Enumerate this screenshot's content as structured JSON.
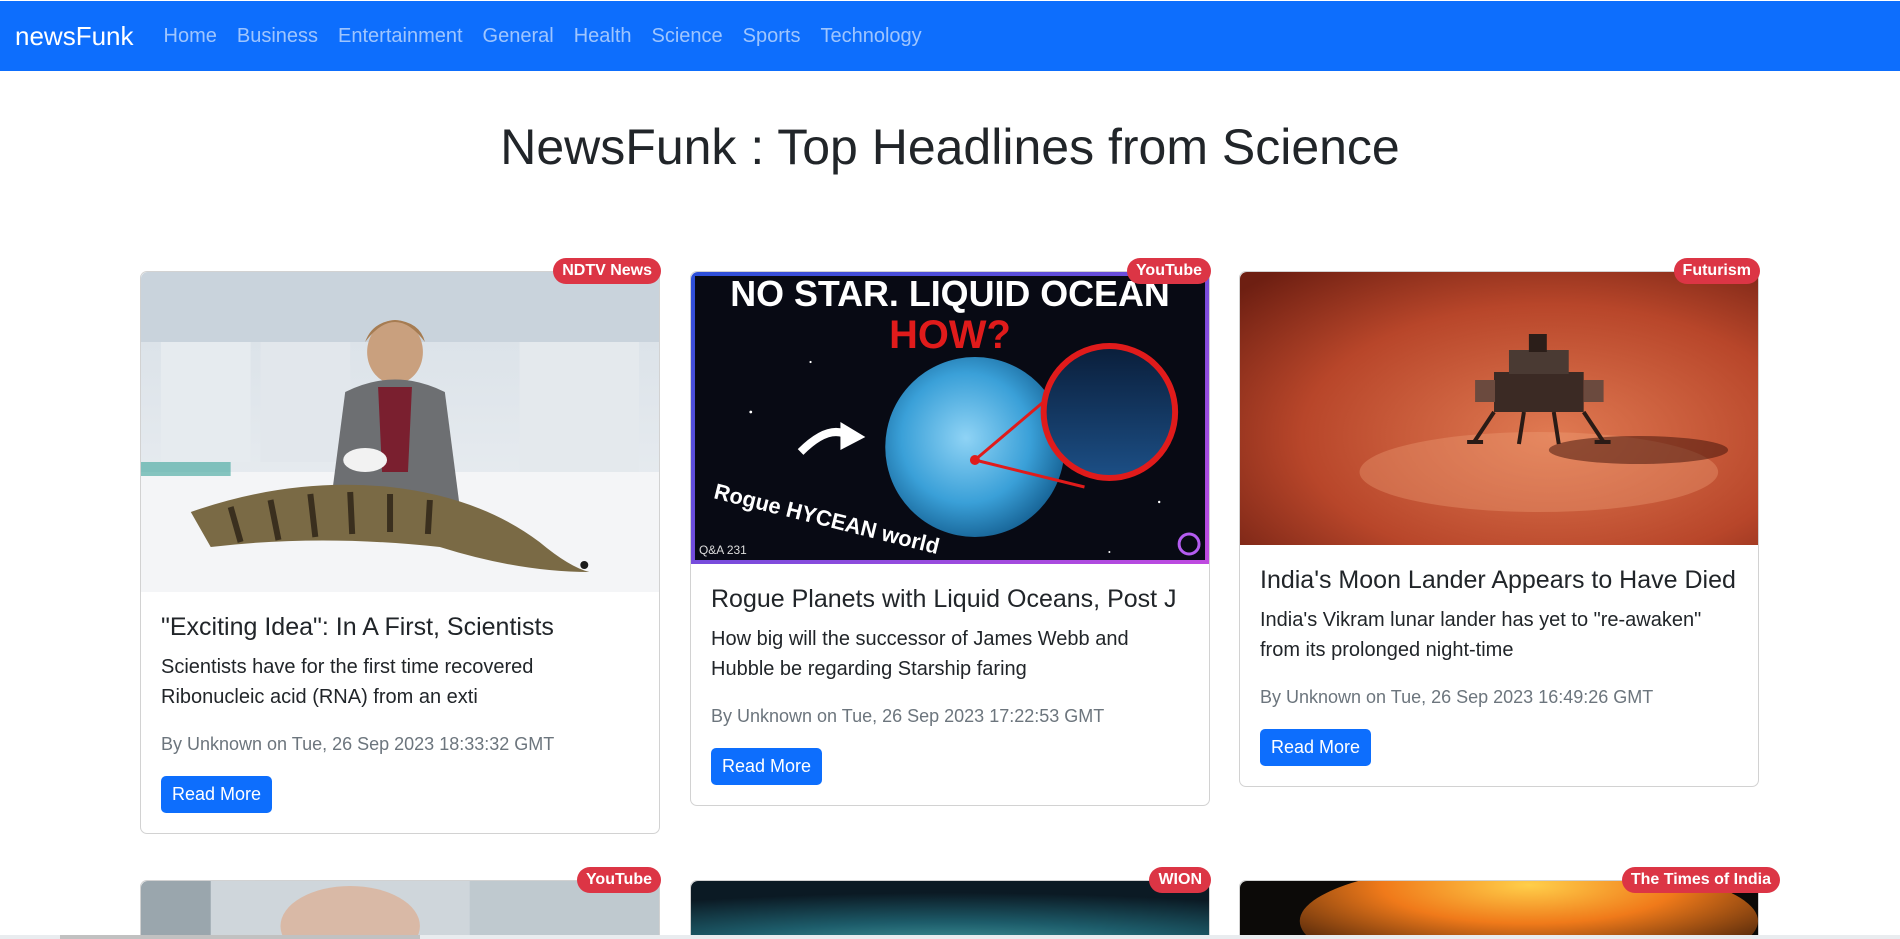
{
  "nav": {
    "brand": "newsFunk",
    "links": [
      "Home",
      "Business",
      "Entertainment",
      "General",
      "Health",
      "Science",
      "Sports",
      "Technology"
    ]
  },
  "page_title": "NewsFunk : Top Headlines from Science",
  "cards": [
    {
      "source": "NDTV News",
      "title": "\"Exciting Idea\": In A First, Scientists",
      "description": "Scientists have for the first time recovered Ribonucleic acid (RNA) from an exti",
      "meta": "By Unknown on Tue, 26 Sep 2023 18:33:32 GMT",
      "button": "Read More"
    },
    {
      "source": "YouTube",
      "title": "Rogue Planets with Liquid Oceans, Post J",
      "description": "How big will the successor of James Webb and Hubble be regarding Starship faring",
      "meta": "By Unknown on Tue, 26 Sep 2023 17:22:53 GMT",
      "button": "Read More",
      "thumb": {
        "line1": "NO STAR. LIQUID OCEAN",
        "line2": "HOW?",
        "caption": "Rogue HYCEAN world",
        "episode": "Q&A 231"
      }
    },
    {
      "source": "Futurism",
      "title": "India's Moon Lander Appears to Have Died",
      "description": "India's Vikram lunar lander has yet to \"re-awaken\" from its prolonged night-time",
      "meta": "By Unknown on Tue, 26 Sep 2023 16:49:26 GMT",
      "button": "Read More"
    },
    {
      "source": "YouTube"
    },
    {
      "source": "WION"
    },
    {
      "source": "The Times of India"
    }
  ],
  "colors": {
    "primary": "#0d6efd",
    "badge": "#dc3545",
    "muted": "#6c757d"
  }
}
